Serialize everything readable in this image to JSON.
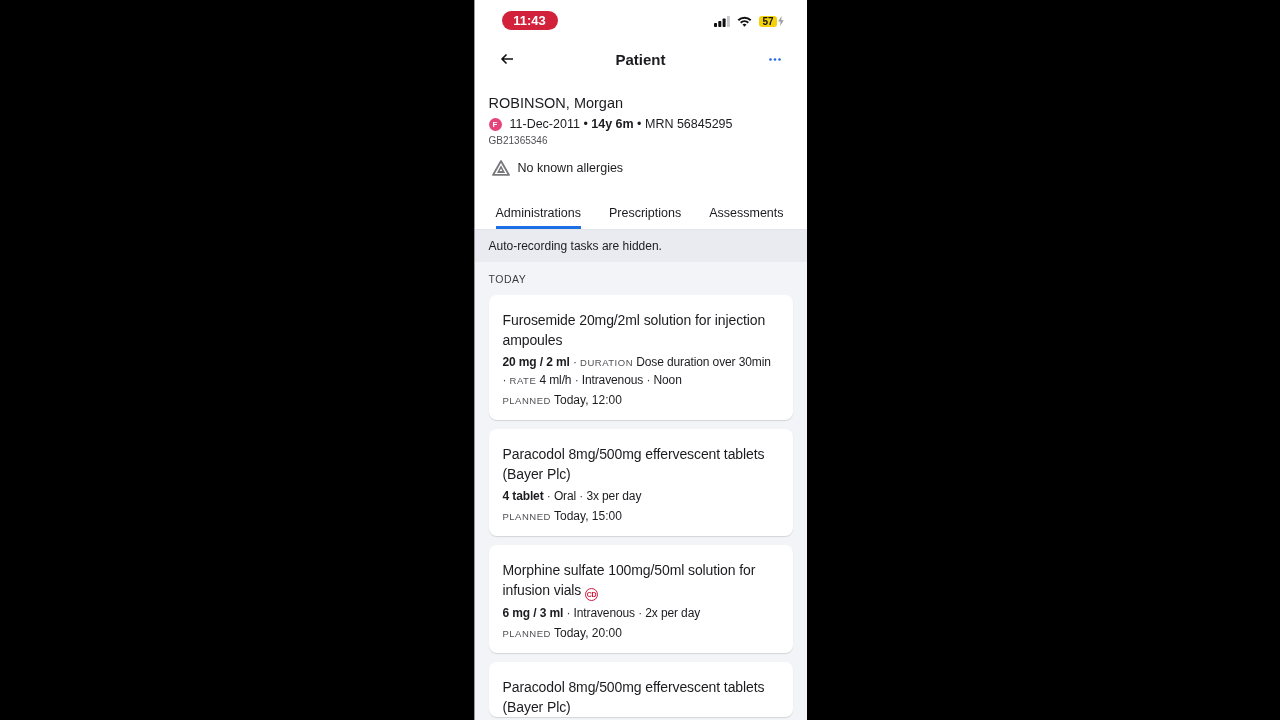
{
  "status_bar": {
    "time": "11:43",
    "battery": "57",
    "low_power": true,
    "charging": true
  },
  "header": {
    "title": "Patient"
  },
  "patient": {
    "name": "ROBINSON, Morgan",
    "sex": "F",
    "demographics": "11-Dec-2011 • **14y 6m** • MRN 56845295",
    "identifier": "GB21365346",
    "allergies": "No known allergies"
  },
  "tabs": [
    {
      "label": "Administrations",
      "selected": true
    },
    {
      "label": "Prescriptions",
      "selected": false
    },
    {
      "label": "Assessments",
      "selected": false
    }
  ],
  "notice": "Auto-recording tasks are hidden.",
  "sections": [
    {
      "heading": "TODAY",
      "administrations": [
        {
          "name": "Furosemide 20mg/2ml solution for injection ampoules",
          "details": [
            {
              "kind": "dose",
              "text": "20 mg / 2 ml"
            },
            {
              "kind": "separator",
              "text": "·"
            },
            {
              "kind": "label",
              "text": "DURATION"
            },
            {
              "kind": "value",
              "text": "Dose duration over 30min"
            },
            {
              "kind": "separator",
              "text": "·"
            },
            {
              "kind": "label",
              "text": "RATE"
            },
            {
              "kind": "value",
              "text": "4 ml/h"
            },
            {
              "kind": "separator",
              "text": "·"
            },
            {
              "kind": "value",
              "text": "Intravenous"
            },
            {
              "kind": "separator",
              "text": "·"
            },
            {
              "kind": "value",
              "text": "Noon"
            }
          ],
          "planned": {
            "label": "PLANNED",
            "value": "Today, 12:00"
          }
        },
        {
          "name": "Paracodol 8mg/500mg effervescent tablets (Bayer Plc)",
          "details": [
            {
              "kind": "dose",
              "text": "4 tablet"
            },
            {
              "kind": "separator",
              "text": "·"
            },
            {
              "kind": "value",
              "text": "Oral"
            },
            {
              "kind": "separator",
              "text": "·"
            },
            {
              "kind": "value",
              "text": "3x per day"
            }
          ],
          "planned": {
            "label": "PLANNED",
            "value": "Today, 15:00"
          }
        },
        {
          "name": "Morphine sulfate 100mg/50ml solution for infusion vials",
          "badge": "CD",
          "details": [
            {
              "kind": "dose",
              "text": "6 mg / 3 ml"
            },
            {
              "kind": "separator",
              "text": "·"
            },
            {
              "kind": "value",
              "text": "Intravenous"
            },
            {
              "kind": "separator",
              "text": "·"
            },
            {
              "kind": "value",
              "text": "2x per day"
            }
          ],
          "planned": {
            "label": "PLANNED",
            "value": "Today, 20:00"
          }
        },
        {
          "name": "Paracodol 8mg/500mg effervescent tablets (Bayer Plc)"
        }
      ]
    }
  ]
}
